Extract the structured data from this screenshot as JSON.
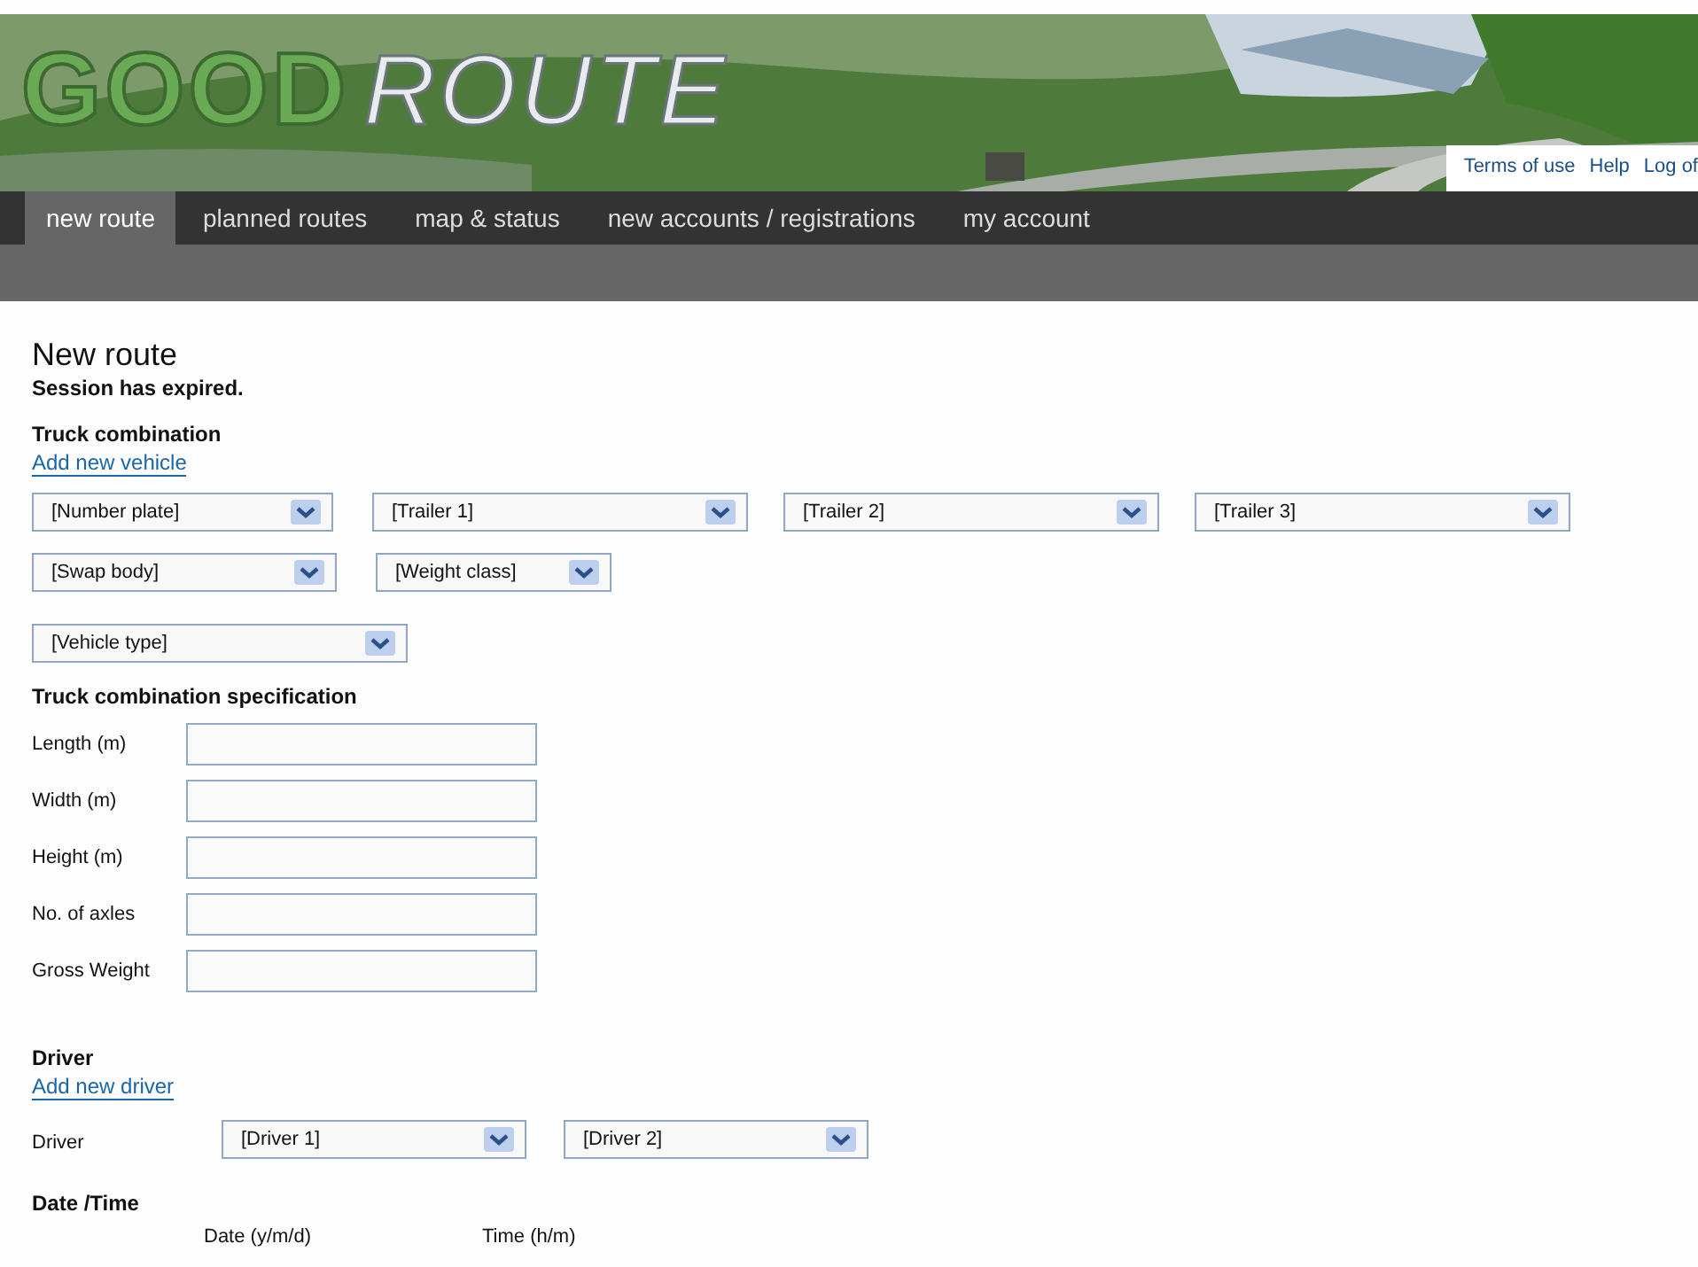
{
  "logo": {
    "word_1": "GOOD",
    "word_2": "ROUTE"
  },
  "top_links": [
    "Terms of use",
    "Help",
    "Log of"
  ],
  "tabs": [
    {
      "label": "new route",
      "selected": true
    },
    {
      "label": "planned routes",
      "selected": false
    },
    {
      "label": "map & status",
      "selected": false
    },
    {
      "label": "new accounts / registrations",
      "selected": false
    },
    {
      "label": "my account",
      "selected": false
    }
  ],
  "page_title": "New route",
  "message": "Session has expired.",
  "truck_combination": {
    "heading": "Truck combination",
    "link": "Add new vehicle",
    "select_rows": [
      [
        "[Number plate]",
        "[Trailer 1]",
        "[Trailer 2]",
        "[Trailer 3]"
      ],
      [
        "[Swap body]",
        "[Weight class]"
      ],
      [
        "[Vehicle type]"
      ]
    ]
  },
  "specification": {
    "heading": "Truck combination specification",
    "fields": [
      {
        "label": "Length (m)"
      },
      {
        "label": "Width (m)"
      },
      {
        "label": "Height (m)"
      },
      {
        "label": "No. of axles"
      },
      {
        "label": "Gross Weight"
      }
    ]
  },
  "driver": {
    "heading": "Driver",
    "link": "Add new driver",
    "label": "Driver",
    "selects": [
      "[Driver 1]",
      "[Driver 2]"
    ]
  },
  "date_time": {
    "heading": "Date /Time",
    "column_1": "Date (y/m/d)",
    "column_2": "Time (h/m)"
  }
}
